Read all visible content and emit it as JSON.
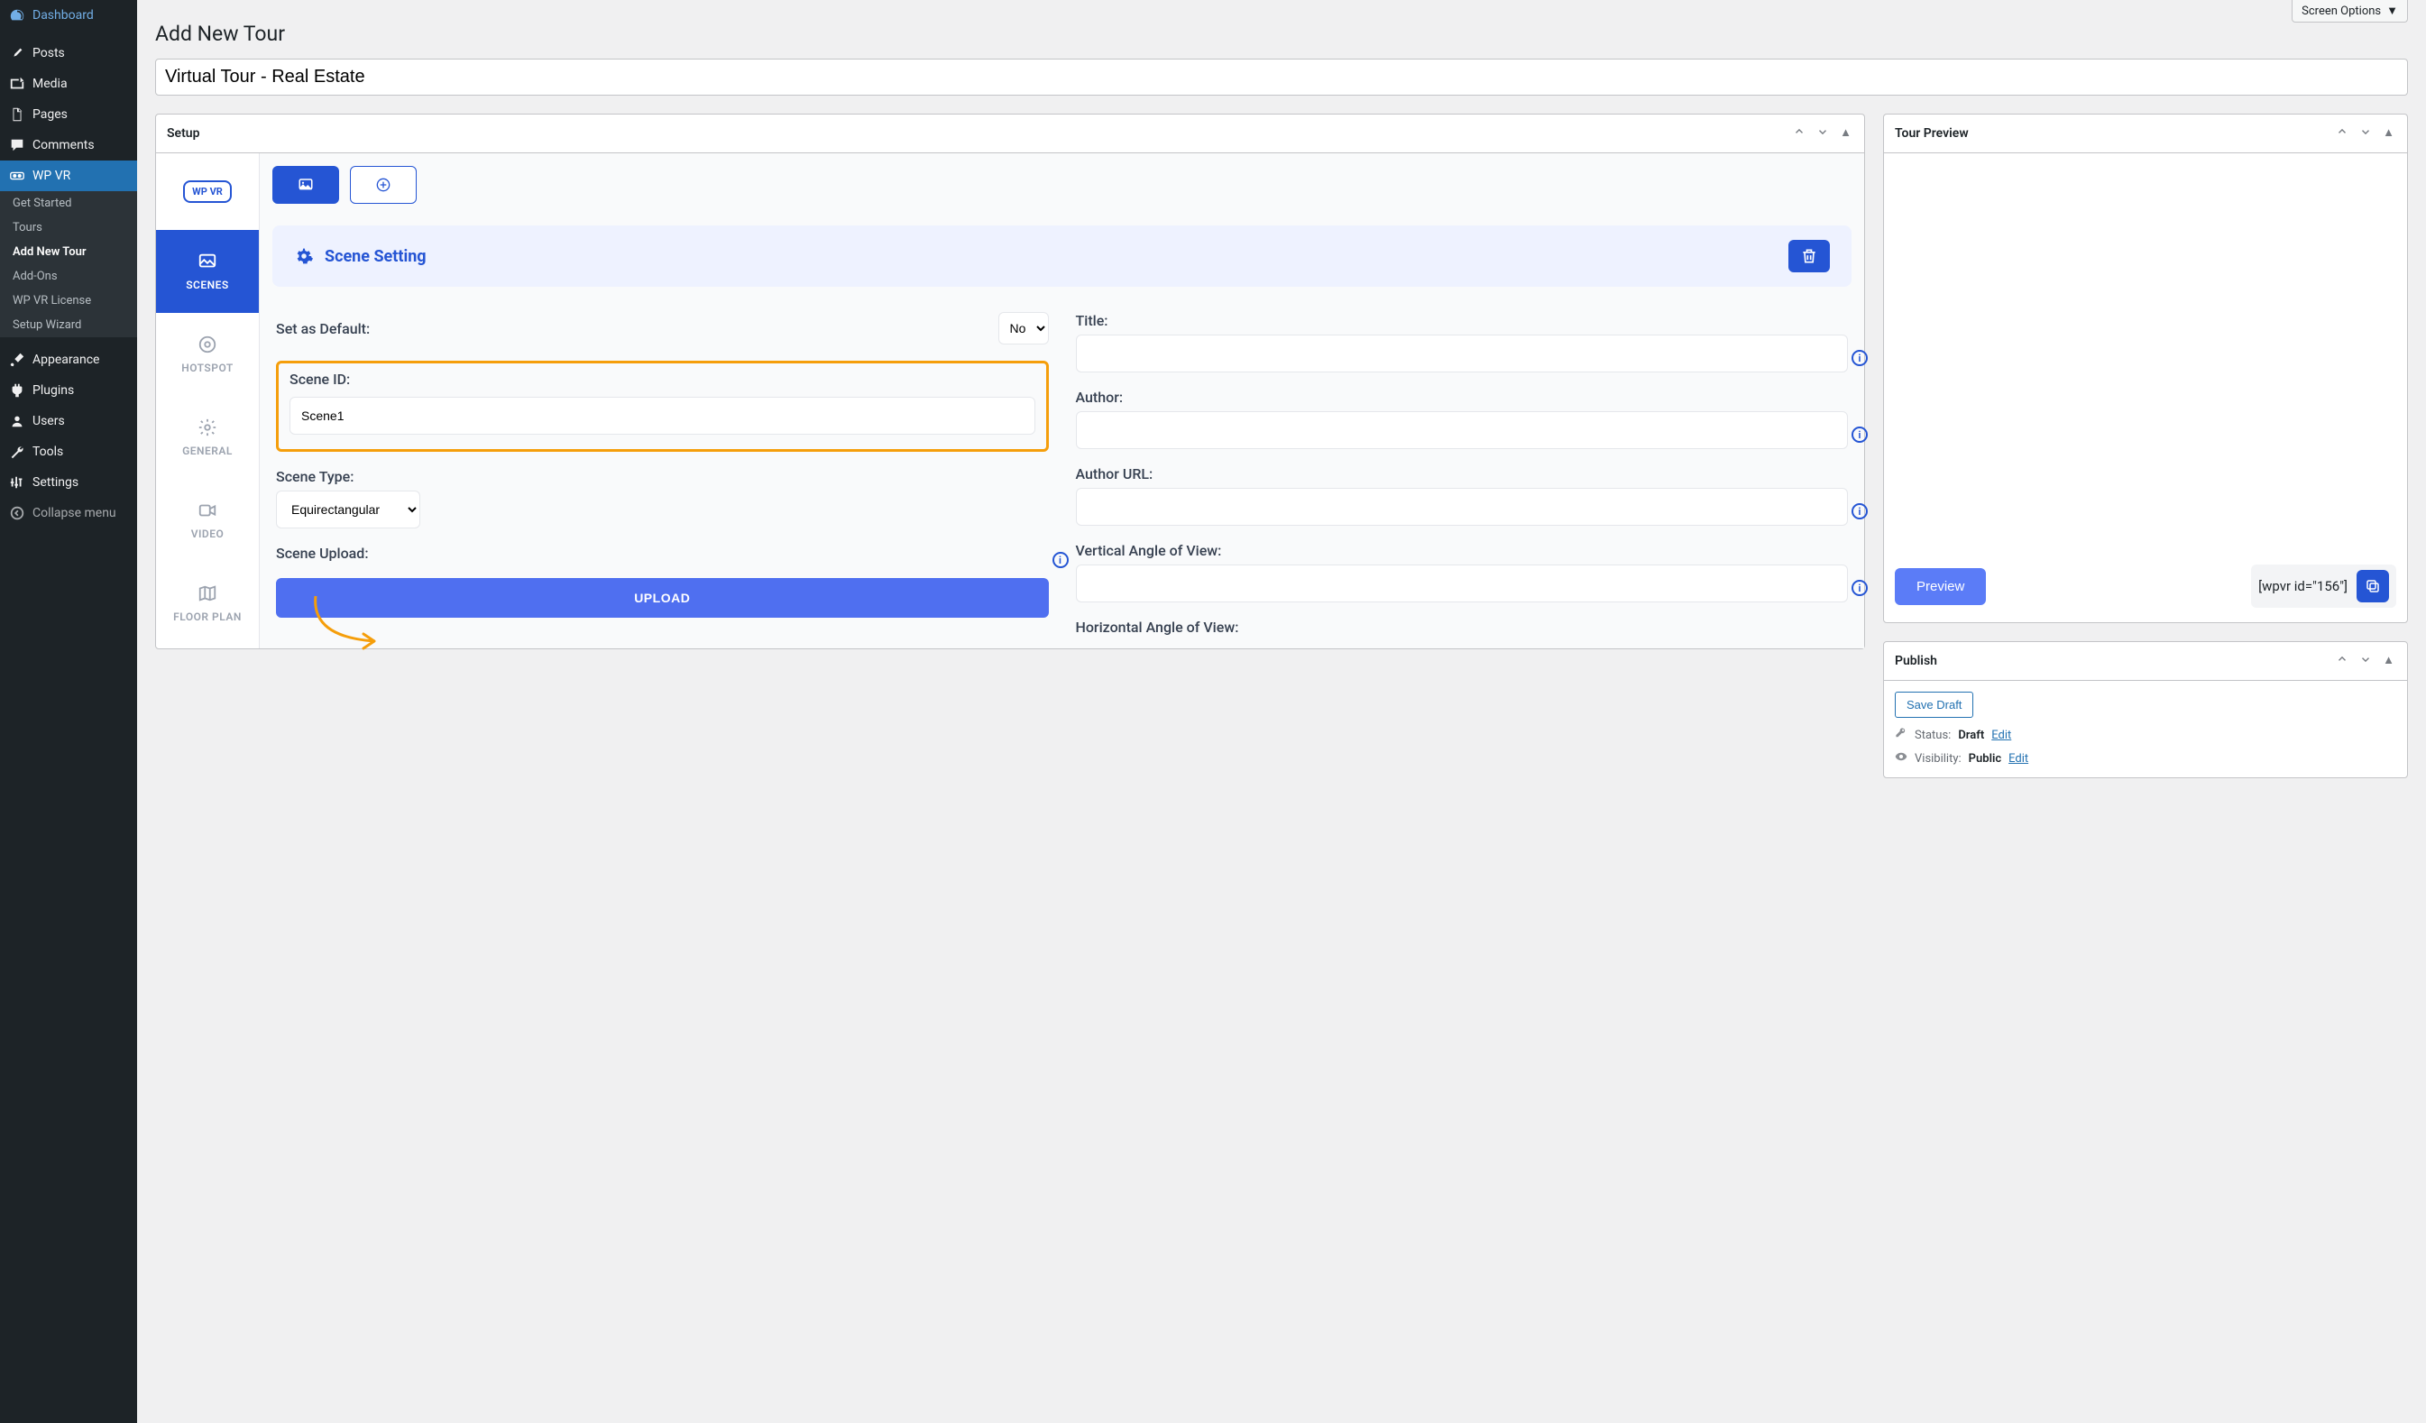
{
  "sidebar": {
    "items": [
      {
        "label": "Dashboard",
        "icon": "dashboard"
      },
      {
        "label": "Posts",
        "icon": "pin"
      },
      {
        "label": "Media",
        "icon": "media"
      },
      {
        "label": "Pages",
        "icon": "page"
      },
      {
        "label": "Comments",
        "icon": "comment"
      },
      {
        "label": "WP VR",
        "icon": "wpvr",
        "active": true
      },
      {
        "label": "Appearance",
        "icon": "brush"
      },
      {
        "label": "Plugins",
        "icon": "plug"
      },
      {
        "label": "Users",
        "icon": "user"
      },
      {
        "label": "Tools",
        "icon": "wrench"
      },
      {
        "label": "Settings",
        "icon": "sliders"
      },
      {
        "label": "Collapse menu",
        "icon": "collapse"
      }
    ],
    "submenu": [
      {
        "label": "Get Started"
      },
      {
        "label": "Tours"
      },
      {
        "label": "Add New Tour",
        "active": true
      },
      {
        "label": "Add-Ons"
      },
      {
        "label": "WP VR License"
      },
      {
        "label": "Setup Wizard"
      }
    ]
  },
  "header": {
    "screen_options": "Screen Options",
    "page_title": "Add New Tour",
    "title_value": "Virtual Tour - Real Estate"
  },
  "setup": {
    "panel_title": "Setup",
    "logo_text": "WP VR",
    "vtabs": [
      {
        "label": "SCENES",
        "active": true
      },
      {
        "label": "HOTSPOT"
      },
      {
        "label": "GENERAL"
      },
      {
        "label": "VIDEO"
      },
      {
        "label": "FLOOR PLAN"
      }
    ],
    "scene_setting_title": "Scene Setting",
    "fields": {
      "set_as_default_label": "Set as Default:",
      "set_as_default_value": "No",
      "scene_id_label": "Scene ID:",
      "scene_id_value": "Scene1",
      "scene_type_label": "Scene Type:",
      "scene_type_value": "Equirectangular",
      "scene_upload_label": "Scene Upload:",
      "upload_button": "UPLOAD",
      "title_label": "Title:",
      "author_label": "Author:",
      "author_url_label": "Author URL:",
      "vertical_angle_label": "Vertical Angle of View:",
      "horizontal_angle_label": "Horizontal Angle of View:"
    }
  },
  "preview": {
    "panel_title": "Tour Preview",
    "preview_button": "Preview",
    "shortcode": "[wpvr id=\"156\"]"
  },
  "publish": {
    "panel_title": "Publish",
    "save_draft": "Save Draft",
    "status_label": "Status:",
    "status_value": "Draft",
    "visibility_label": "Visibility:",
    "visibility_value": "Public",
    "edit_label": "Edit"
  }
}
